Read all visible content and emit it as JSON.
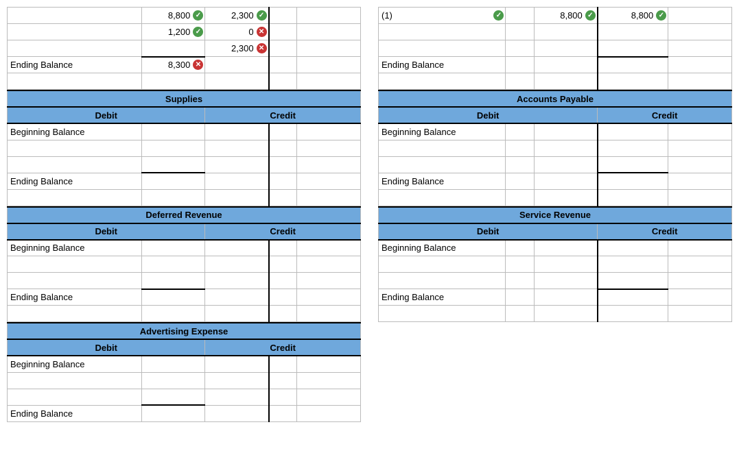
{
  "labels": {
    "ending_balance": "Ending Balance",
    "beginning_balance": "Beginning Balance",
    "debit": "Debit",
    "credit": "Credit"
  },
  "left_top": {
    "r1_c2": "8,800",
    "r1_c2_status": "correct",
    "r1_c3": "2,300",
    "r1_c3_status": "correct",
    "r2_c2": "1,200",
    "r2_c2_status": "correct",
    "r2_c3": "0",
    "r2_c3_status": "wrong",
    "r3_c3": "2,300",
    "r3_c3_status": "wrong",
    "end_c2": "8,300",
    "end_c2_status": "wrong"
  },
  "right_top": {
    "r1_c1": "(1)",
    "r1_c1_status": "correct",
    "r1_c3": "8,800",
    "r1_c3_status": "correct",
    "r1_c4": "8,800",
    "r1_c4_status": "correct"
  },
  "accounts": {
    "supplies": "Supplies",
    "accounts_payable": "Accounts Payable",
    "deferred_revenue": "Deferred Revenue",
    "service_revenue": "Service Revenue",
    "advertising_expense": "Advertising Expense"
  }
}
